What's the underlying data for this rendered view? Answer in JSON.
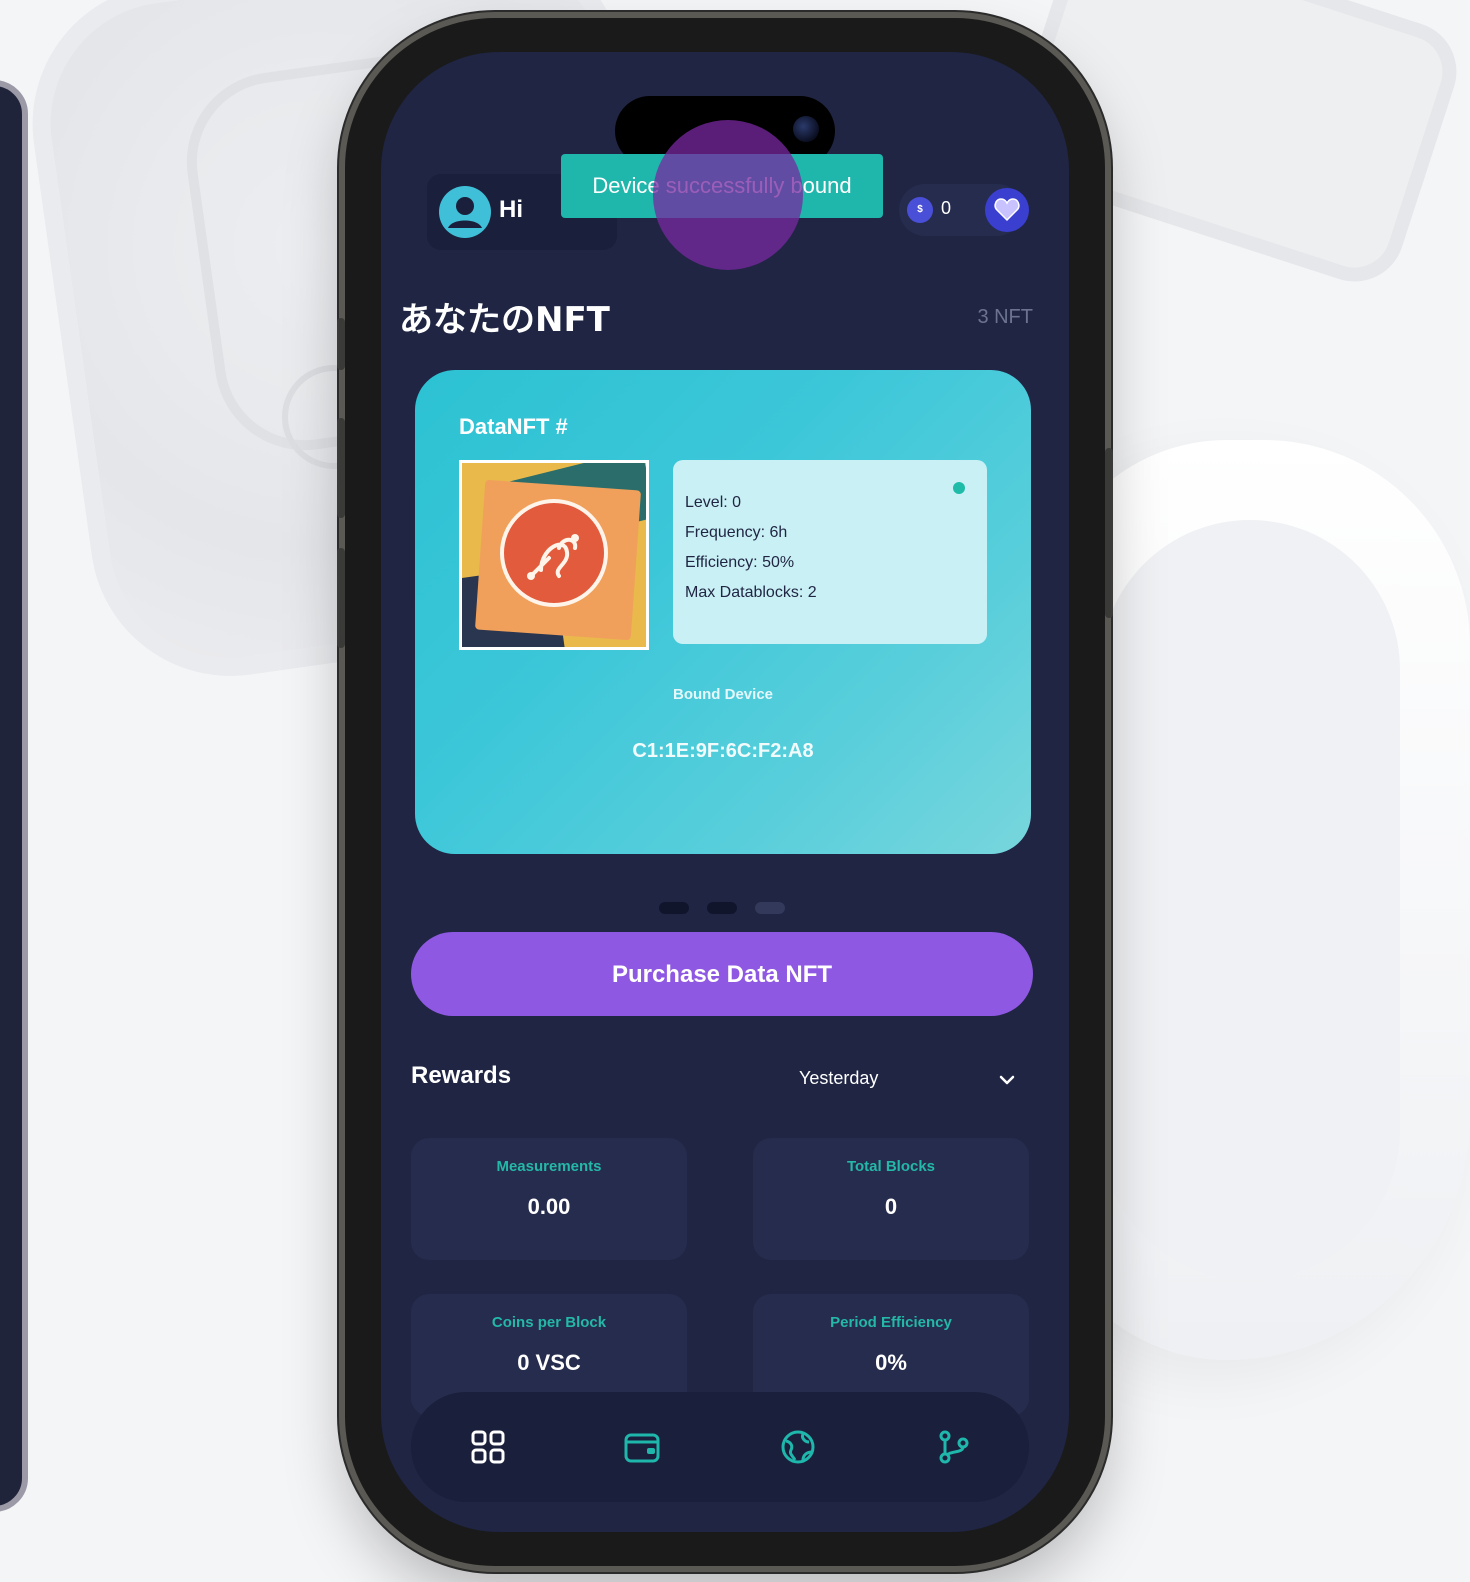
{
  "header": {
    "greeting": "Hi",
    "coin_icon_label": "$",
    "coin_balance": "0"
  },
  "toast": {
    "message": "Device successfully bound"
  },
  "nfts": {
    "title": "あなたのNFT",
    "count_label": "3 NFT"
  },
  "nft_card": {
    "title": "DataNFT #",
    "info": {
      "level": "Level: 0",
      "frequency": "Frequency: 6h",
      "efficiency": "Efficiency: 50%",
      "max_datablocks": "Max Datablocks: 2"
    },
    "bound_device_label": "Bound Device",
    "bound_device_id": "C1:1E:9F:6C:F2:A8"
  },
  "pager": {
    "total": 3,
    "active_index": 1
  },
  "purchase_button": {
    "label": "Purchase Data NFT"
  },
  "rewards": {
    "title": "Rewards",
    "period": "Yesterday",
    "stats": [
      {
        "label": "Measurements",
        "value": "0.00"
      },
      {
        "label": "Total Blocks",
        "value": "0"
      },
      {
        "label": "Coins per Block",
        "value": "0 VSC"
      },
      {
        "label": "Period Efficiency",
        "value": "0%"
      }
    ]
  },
  "bottom_nav": {
    "items": [
      "dashboard-icon",
      "wallet-icon",
      "globe-icon",
      "branch-icon"
    ]
  },
  "colors": {
    "screen_bg": "#1f2543",
    "accent_teal": "#1fb6ab",
    "accent_purple": "#8f58e3",
    "card_gradient_start": "#2cc2d3",
    "card_gradient_end": "#78d6dd"
  }
}
